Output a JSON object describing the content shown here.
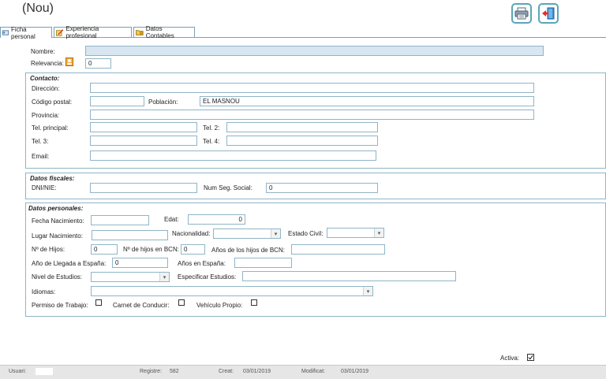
{
  "header": {
    "title": "(Nou)",
    "print_icon": "printer-icon",
    "exit_icon": "exit-door-icon"
  },
  "tabs": [
    {
      "label": "Ficha personal",
      "icon": "id-card-icon",
      "active": true
    },
    {
      "label": "Experiencia profesional",
      "icon": "edit-note-icon",
      "active": false
    },
    {
      "label": "Datos Contables",
      "icon": "folder-coins-icon",
      "active": false
    }
  ],
  "form": {
    "nombre_label": "Nombre:",
    "nombre_value": "",
    "relevancia_label": "Relevancia:",
    "relevancia_value": "0",
    "contacto": {
      "title": "Contacto:",
      "direccion_label": "Dirección:",
      "direccion_value": "",
      "cp_label": "Código postal:",
      "cp_value": "",
      "poblacion_label": "Población:",
      "poblacion_value": "EL MASNOU",
      "provincia_label": "Provincia:",
      "provincia_value": "",
      "tel_principal_label": "Tel. principal:",
      "tel2_label": "Tel. 2:",
      "tel3_label": "Tel. 3:",
      "tel4_label": "Tel. 4:",
      "email_label": "Email:"
    },
    "fiscales": {
      "title": "Datos fiscales:",
      "dni_label": "DNI/NIE:",
      "dni_value": "",
      "nss_label": "Num Seg. Social:",
      "nss_value": "0"
    },
    "personales": {
      "title": "Datos personales:",
      "fecha_nac_label": "Fecha Nacimiento:",
      "edat_label": "Edat:",
      "edat_value": "0",
      "lugar_nac_label": "Lugar Nacimiento:",
      "nacionalidad_label": "Nacionalidad:",
      "estado_civil_label": "Estado Civil:",
      "num_hijos_label": "Nº de Hijos:",
      "num_hijos_value": "0",
      "hijos_bcn_label": "Nº de hijos en BCN:",
      "hijos_bcn_value": "0",
      "anos_hijos_bcn_label": "Años de los hijos de BCN:",
      "ano_llegada_label": "Año de Llegada a España:",
      "ano_llegada_value": "0",
      "anos_espana_label": "Años en España:",
      "nivel_estudios_label": "Nivel de Estudios:",
      "especificar_estudios_label": "Especificar Estudios:",
      "idiomas_label": "Idiomas:",
      "permiso_trabajo_label": "Permiso de Trabajo:",
      "carnet_label": "Carnet de Conducir:",
      "vehiculo_label": "Vehículo Propio:"
    },
    "activa_label": "Activa:",
    "activa_checked": true
  },
  "status_bar": {
    "usuari_label": "Usuari:",
    "registre_label": "Registre:",
    "registre_value": "582",
    "creat_label": "Creat:",
    "creat_value": "03/01/2019",
    "modificat_label": "Modificat:",
    "modificat_value": "03/01/2019"
  },
  "colors": {
    "field_border": "#8fb5c6",
    "button_border": "#5aa6b8",
    "highlight_field": "#d7e6f0"
  }
}
